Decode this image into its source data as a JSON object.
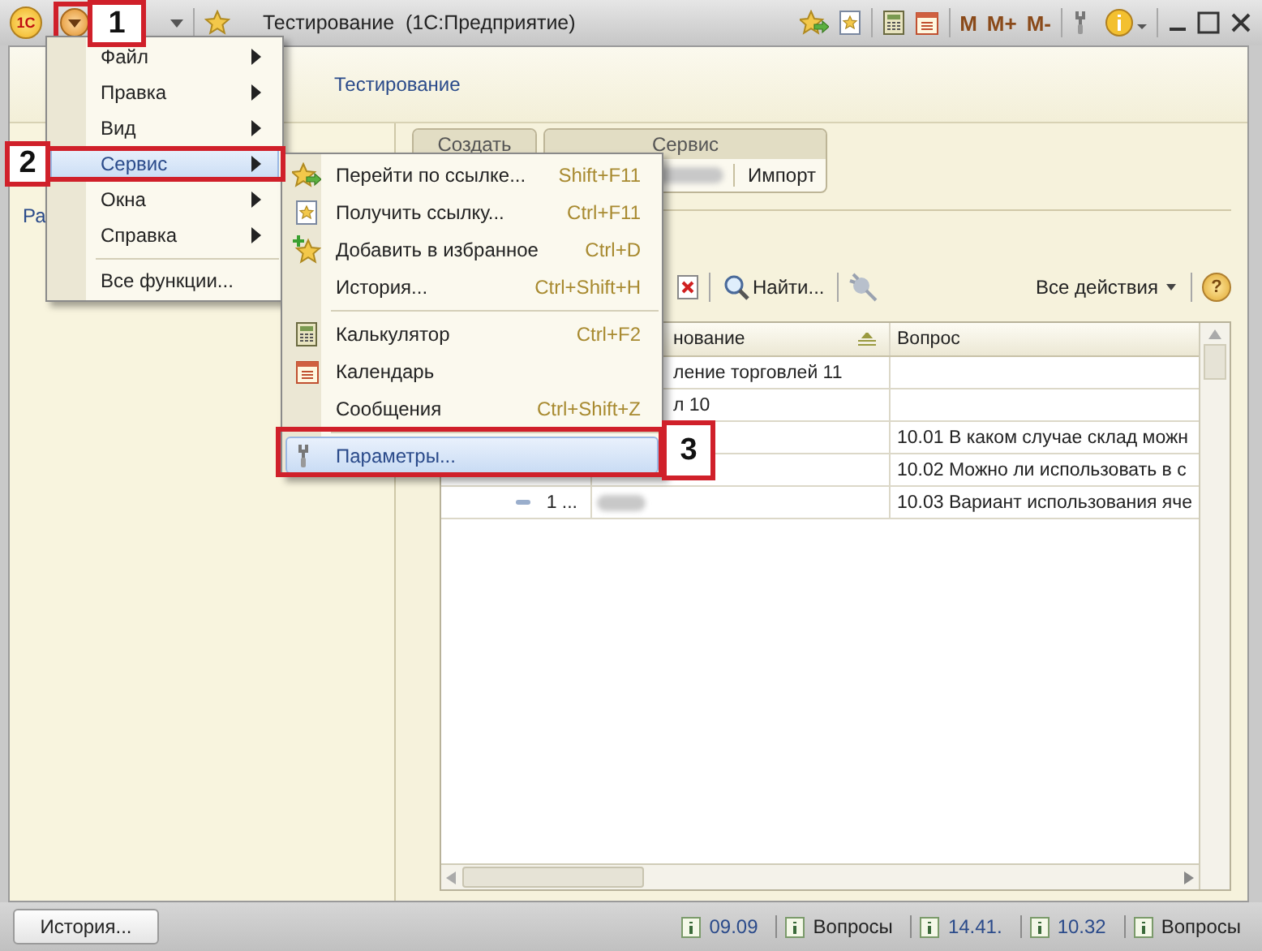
{
  "window": {
    "logo": "1С",
    "title": "Тестирование  (1С:Предприятие)",
    "memory_buttons": [
      "M",
      "M+",
      "M-"
    ]
  },
  "section_title": "Тестирование",
  "left_panel": {
    "text": "Ра"
  },
  "command_groups": [
    {
      "title": "Создать"
    },
    {
      "title": "Сервис",
      "buttons": [
        "Импорт"
      ]
    }
  ],
  "list_toolbar": {
    "find": "Найти...",
    "all_actions": "Все действия",
    "help": "?"
  },
  "table": {
    "columns": [
      "нование",
      "Вопрос"
    ],
    "rows": [
      {
        "kind": "plain",
        "name": "ление торговлей 11"
      },
      {
        "kind": "plain",
        "name": "л 10"
      },
      {
        "kind": "plain",
        "question": "10.01 В каком случае склад можн"
      },
      {
        "kind": "plain",
        "question": "10.02 Можно ли использовать в с"
      },
      {
        "kind": "group",
        "expanded": true,
        "tree": "1 ...",
        "question": "10.03 Вариант использования яче"
      }
    ]
  },
  "main_menu": [
    {
      "kind": "item",
      "label": "Файл",
      "submenu": true,
      "selected": false
    },
    {
      "kind": "item",
      "label": "Правка",
      "submenu": true,
      "selected": false
    },
    {
      "kind": "item",
      "label": "Вид",
      "submenu": true,
      "selected": false
    },
    {
      "kind": "item",
      "label": "Сервис",
      "submenu": true,
      "selected": true
    },
    {
      "kind": "item",
      "label": "Окна",
      "submenu": true,
      "selected": false
    },
    {
      "kind": "item",
      "label": "Справка",
      "submenu": true,
      "selected": false
    },
    {
      "kind": "separator"
    },
    {
      "kind": "item",
      "label": "Все функции...",
      "submenu": false,
      "selected": false
    }
  ],
  "service_menu": [
    {
      "kind": "item",
      "label": "Перейти по ссылке...",
      "shortcut": "Shift+F11",
      "selected": false
    },
    {
      "kind": "item",
      "label": "Получить ссылку...",
      "shortcut": "Ctrl+F11",
      "selected": false
    },
    {
      "kind": "item",
      "label": "Добавить в избранное",
      "shortcut": "Ctrl+D",
      "selected": false
    },
    {
      "kind": "item",
      "label": "История...",
      "shortcut": "Ctrl+Shift+H",
      "selected": false
    },
    {
      "kind": "separator"
    },
    {
      "kind": "item",
      "label": "Калькулятор",
      "shortcut": "Ctrl+F2",
      "selected": false
    },
    {
      "kind": "item",
      "label": "Календарь",
      "selected": false
    },
    {
      "kind": "item",
      "label": "Сообщения",
      "shortcut": "Ctrl+Shift+Z",
      "selected": false
    },
    {
      "kind": "separator"
    },
    {
      "kind": "item",
      "label": "Параметры...",
      "selected": true
    }
  ],
  "callouts": [
    "1",
    "2",
    "3"
  ],
  "status_bar": {
    "history_button": "История...",
    "items": [
      {
        "kind": "link",
        "text": "09.09"
      },
      {
        "kind": "text",
        "text": "Вопросы"
      },
      {
        "kind": "link",
        "text": "14.41."
      },
      {
        "kind": "link",
        "text": "10.32"
      },
      {
        "kind": "text",
        "text": "Вопросы"
      }
    ]
  }
}
